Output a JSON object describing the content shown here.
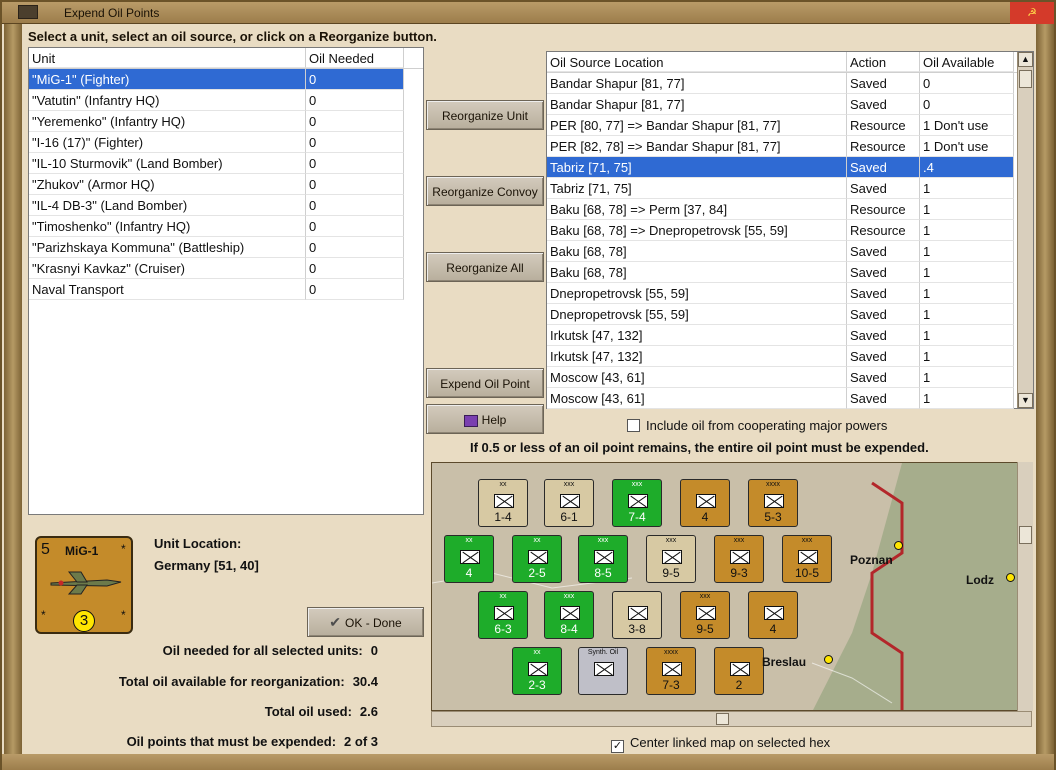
{
  "window": {
    "title": "Expend Oil Points"
  },
  "instruction": "Select a unit, select an oil source, or click on a Reorganize button.",
  "unit_table": {
    "columns": [
      "Unit",
      "Oil Needed"
    ],
    "rows": [
      [
        "\"MiG-1\" (Fighter)",
        "0"
      ],
      [
        "\"Vatutin\" (Infantry HQ)",
        "0"
      ],
      [
        "\"Yeremenko\" (Infantry HQ)",
        "0"
      ],
      [
        "\"I-16 (17)\" (Fighter)",
        "0"
      ],
      [
        "\"IL-10 Sturmovik\" (Land Bomber)",
        "0"
      ],
      [
        "\"Zhukov\" (Armor HQ)",
        "0"
      ],
      [
        "\"IL-4 DB-3\" (Land Bomber)",
        "0"
      ],
      [
        "\"Timoshenko\" (Infantry HQ)",
        "0"
      ],
      [
        "\"Parizhskaya Kommuna\" (Battleship)",
        "0"
      ],
      [
        "\"Krasnyi Kavkaz\" (Cruiser)",
        "0"
      ],
      [
        "Naval Transport",
        "0"
      ]
    ],
    "selected_index": 0
  },
  "oil_table": {
    "columns": [
      "Oil Source Location",
      "Action",
      "Oil Available"
    ],
    "rows": [
      [
        "Bandar Shapur [81, 77]",
        "Saved",
        "0"
      ],
      [
        "Bandar Shapur [81, 77]",
        "Saved",
        "0"
      ],
      [
        "PER [80, 77] => Bandar Shapur [81, 77]",
        "Resource",
        "1 Don't use"
      ],
      [
        "PER [82, 78] => Bandar Shapur [81, 77]",
        "Resource",
        "1 Don't use"
      ],
      [
        "Tabriz [71, 75]",
        "Saved",
        ".4"
      ],
      [
        "Tabriz [71, 75]",
        "Saved",
        "1"
      ],
      [
        "Baku [68, 78] => Perm [37, 84]",
        "Resource",
        "1"
      ],
      [
        "Baku [68, 78] => Dnepropetrovsk [55, 59]",
        "Resource",
        "1"
      ],
      [
        "Baku [68, 78]",
        "Saved",
        "1"
      ],
      [
        "Baku [68, 78]",
        "Saved",
        "1"
      ],
      [
        "Dnepropetrovsk [55, 59]",
        "Saved",
        "1"
      ],
      [
        "Dnepropetrovsk [55, 59]",
        "Saved",
        "1"
      ],
      [
        "Irkutsk [47, 132]",
        "Saved",
        "1"
      ],
      [
        "Irkutsk [47, 132]",
        "Saved",
        "1"
      ],
      [
        "Moscow [43, 61]",
        "Saved",
        "1"
      ],
      [
        "Moscow [43, 61]",
        "Saved",
        "1"
      ]
    ],
    "selected_index": 4
  },
  "buttons": {
    "reorganize_unit": "Reorganize Unit",
    "reorganize_convoy": "Reorganize Convoy",
    "reorganize_all": "Reorganize All",
    "expend_oil_point": "Expend Oil Point",
    "help": "Help",
    "ok_done": "OK - Done"
  },
  "coop_checkbox": {
    "label": "Include oil from cooperating major powers",
    "checked": false
  },
  "oil_note": "If 0.5 or less of an oil point remains, the entire oil point must be expended.",
  "counter": {
    "strength": "5",
    "name": "MiG-1",
    "badge": "3",
    "color": "#c48b2a",
    "icon": "fighter-plane-icon"
  },
  "location": {
    "label": "Unit Location:",
    "value": "Germany [51, 40]"
  },
  "stats": {
    "oil_needed": {
      "label": "Oil needed for all selected units:",
      "value": "0"
    },
    "total_available": {
      "label": "Total oil available for reorganization:",
      "value": "30.4"
    },
    "total_used": {
      "label": "Total oil used:",
      "value": "2.6"
    },
    "must_expend": {
      "label": "Oil points that must be expended:",
      "value": "2 of 3"
    }
  },
  "map": {
    "cities": [
      "Poznan",
      "Lodz",
      "Breslau"
    ],
    "counters": [
      {
        "top": "xx",
        "label": "1-4",
        "color": "tan"
      },
      {
        "top": "xxx",
        "label": "6-1",
        "color": "tan"
      },
      {
        "top": "xxx",
        "label": "7-4",
        "color": "green"
      },
      {
        "top": "",
        "label": "4",
        "color": "brown"
      },
      {
        "top": "xxxx",
        "label": "5-3",
        "color": "brown"
      },
      {
        "top": "xx",
        "label": "4",
        "color": "green"
      },
      {
        "top": "xx",
        "label": "2-5",
        "color": "green"
      },
      {
        "top": "xxx",
        "label": "8-5",
        "color": "green"
      },
      {
        "top": "xxx",
        "label": "9-5",
        "color": "tan"
      },
      {
        "top": "xxx",
        "label": "9-3",
        "color": "brown"
      },
      {
        "top": "xxx",
        "label": "10-5",
        "color": "brown"
      },
      {
        "top": "xx",
        "label": "6-3",
        "color": "green"
      },
      {
        "top": "xxx",
        "label": "8-4",
        "color": "green"
      },
      {
        "top": "",
        "label": "3-8",
        "color": "tan"
      },
      {
        "top": "xxx",
        "label": "9-5",
        "color": "brown"
      },
      {
        "top": "",
        "label": "4",
        "color": "brown"
      },
      {
        "top": "xx",
        "label": "2-3",
        "color": "green"
      },
      {
        "top": "Synth. Oil",
        "label": "",
        "color": "gray"
      },
      {
        "top": "xxxx",
        "label": "7-3",
        "color": "brown"
      },
      {
        "top": "",
        "label": "2",
        "color": "brown"
      }
    ]
  },
  "center_checkbox": {
    "label": "Center linked map on selected hex",
    "checked": true
  }
}
